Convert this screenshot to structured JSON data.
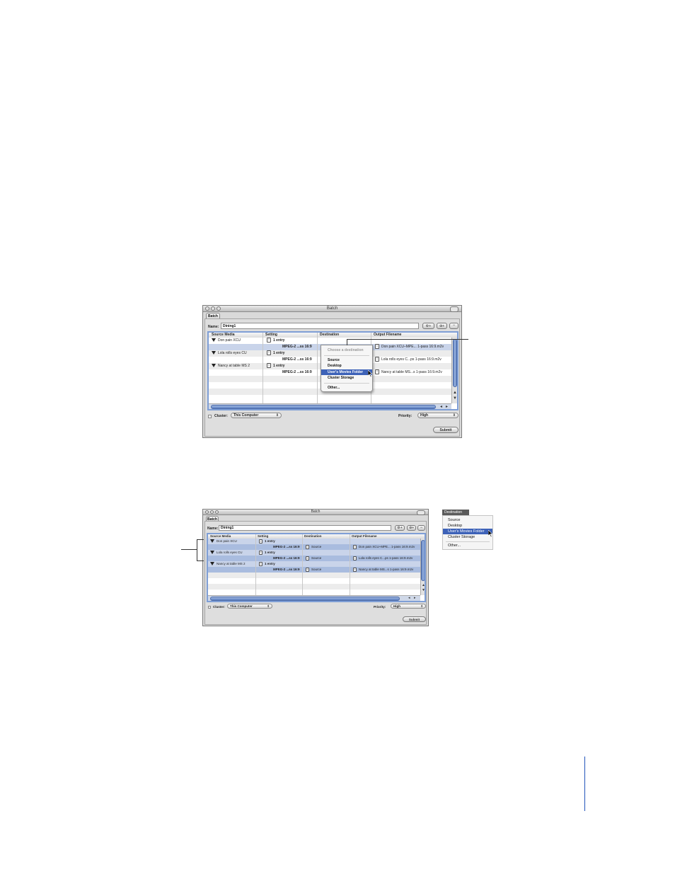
{
  "window1": {
    "title": "Batch",
    "tab": "Batch",
    "name_label": "Name:",
    "name_value": "Dining1",
    "toolbar": {
      "add_setting": "⚙+",
      "add_source": "⊕+",
      "remove": "−"
    },
    "columns": [
      "Source Media",
      "Setting",
      "Destination",
      "Output Filename"
    ],
    "rows": [
      {
        "source": "Don pain XCU",
        "setting": "1 entry",
        "sub_setting": "MPEG-2 ...ss 16:9",
        "output": "Don pain XCU–MPE... 1-pass 16:9.m2v"
      },
      {
        "source": "Lola rolls eyes CU",
        "setting": "1 entry",
        "sub_setting": "MPEG-2 ...ss 16:9",
        "output": "Lola rolls eyes C...ps 1-pass 16:9.m2v"
      },
      {
        "source": "Nancy at table MS 2",
        "setting": "1 entry",
        "sub_setting": "MPEG-2 ...ss 16:9",
        "output": "Nancy at table MS...s 1-pass 16:9.m2v"
      }
    ],
    "menu": {
      "header": "Choose a destination",
      "items": [
        "Source",
        "Desktop",
        "User's Movies Folder",
        "Cluster Storage",
        "Other..."
      ],
      "selected": "User's Movies Folder"
    },
    "cluster_label": "Cluster:",
    "cluster_value": "This Computer",
    "priority_label": "Priority:",
    "priority_value": "High",
    "submit": "Submit"
  },
  "window2": {
    "title": "Batch",
    "tab": "Batch",
    "name_label": "Name:",
    "name_value": "Dining1",
    "toolbar": {
      "add_setting": "⚙+",
      "add_source": "⊕+",
      "remove": "−"
    },
    "columns": [
      "Source Media",
      "Setting",
      "Destination",
      "Output Filename"
    ],
    "rows": [
      {
        "source": "Don pain XCU",
        "setting": "1 entry",
        "sub_setting": "MPEG-2 ...ss 16:9",
        "destination": "Source",
        "output": "Don pain XCU–MPE... 1-pass 16:9.m2v"
      },
      {
        "source": "Lola rolls eyes CU",
        "setting": "1 entry",
        "sub_setting": "MPEG-2 ...ss 16:9",
        "destination": "Source",
        "output": "Lola rolls eyes C...ps 1-pass 16:9.m2v"
      },
      {
        "source": "Nancy at table MS 2",
        "setting": "1 entry",
        "sub_setting": "MPEG-2 ...ss 16:9",
        "destination": "Source",
        "output": "Nancy at table MS...s 1-pass 16:9.m2v"
      }
    ],
    "cluster_label": "Cluster:",
    "cluster_value": "This Computer",
    "priority_label": "Priority:",
    "priority_value": "High",
    "submit": "Submit"
  },
  "detail_menu": {
    "header": "Destination",
    "items": [
      "Source",
      "Desktop",
      "User's Movies Folder",
      "Cluster Storage",
      "Other..."
    ],
    "selected": "User's Movies Folder"
  },
  "colors": {
    "selection": "#3d62b8",
    "table_border": "#7f9fd6",
    "page_rule": "#2255bb"
  }
}
